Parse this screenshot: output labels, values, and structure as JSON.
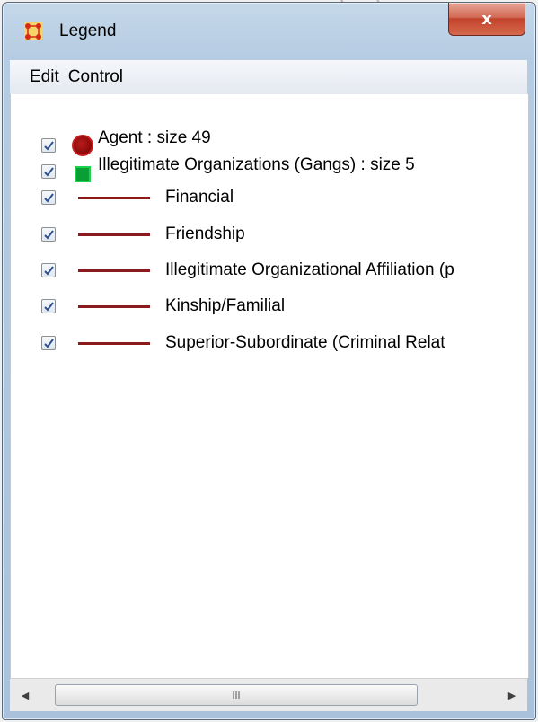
{
  "window": {
    "title": "Legend",
    "close_icon": "close-x-icon",
    "close_glyph": "x",
    "frame_color": "#b6cce2",
    "close_color": "#c2432b"
  },
  "menu": {
    "items": [
      {
        "label": "Edit"
      },
      {
        "label": "Control"
      }
    ]
  },
  "legend": {
    "nodes": [
      {
        "label": "Agent : size 49",
        "shape": "circle",
        "color": "#8b0000",
        "checked": true
      },
      {
        "label": "Illegitimate Organizations (Gangs) : size 5",
        "shape": "square",
        "color": "#0a9f35",
        "checked": true
      }
    ],
    "links": [
      {
        "label": "Financial",
        "color": "#8b1a1a",
        "checked": true
      },
      {
        "label": "Friendship",
        "color": "#8b1a1a",
        "checked": true
      },
      {
        "label": "Illegitimate Organizational Affiliation (p",
        "color": "#8b1a1a",
        "checked": true
      },
      {
        "label": "Kinship/Familial",
        "color": "#8b1a1a",
        "checked": true
      },
      {
        "label": "Superior-Subordinate (Criminal Relat",
        "color": "#8b1a1a",
        "checked": true
      }
    ]
  },
  "scrollbar": {
    "left_arrow": "◀",
    "right_arrow": "▶",
    "thumb_grip_icon": "grip-icon"
  }
}
